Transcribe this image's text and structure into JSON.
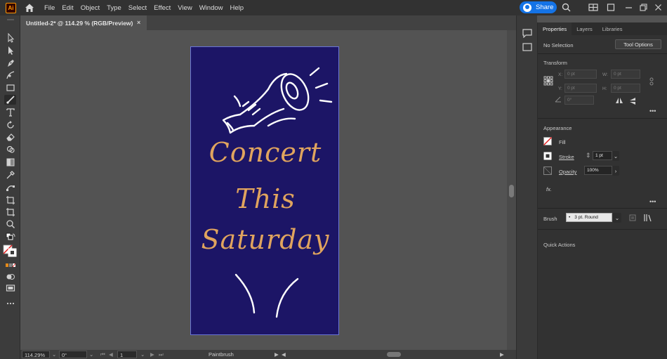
{
  "app": {
    "logo_text": "Ai",
    "brand_color": "#ff9a00"
  },
  "menu": [
    "File",
    "Edit",
    "Object",
    "Type",
    "Select",
    "Effect",
    "View",
    "Window",
    "Help"
  ],
  "share": {
    "label": "Share"
  },
  "document": {
    "tab_title": "Untitled-2* @ 114.29 % (RGB/Preview)",
    "close": "×"
  },
  "artboard": {
    "line1": "Concert",
    "line2": "This",
    "line3": "Saturday",
    "background_color": "#1c1566",
    "text_color": "#e0a45e"
  },
  "status": {
    "zoom": "114.29%",
    "rotation": "0°",
    "artboard_number": "1",
    "current_tool": "Paintbrush"
  },
  "panel": {
    "tabs": [
      "Properties",
      "Layers",
      "Libraries"
    ],
    "selection_label": "No Selection",
    "tool_options_label": "Tool Options",
    "transform": {
      "title": "Transform",
      "x_label": "X:",
      "x_value": "0 pt",
      "y_label": "Y:",
      "y_value": "0 pt",
      "w_label": "W:",
      "w_value": "0 pt",
      "h_label": "H:",
      "h_value": "0 pt",
      "angle_value": "0°"
    },
    "appearance": {
      "title": "Appearance",
      "fill_label": "Fill",
      "stroke_label": "Stroke",
      "stroke_value": "1 pt",
      "opacity_label": "Opacity",
      "opacity_value": "100%",
      "fx_label": "fx."
    },
    "brush": {
      "label": "Brush",
      "value": "3 pt. Round"
    },
    "quick_actions": {
      "title": "Quick Actions"
    }
  }
}
